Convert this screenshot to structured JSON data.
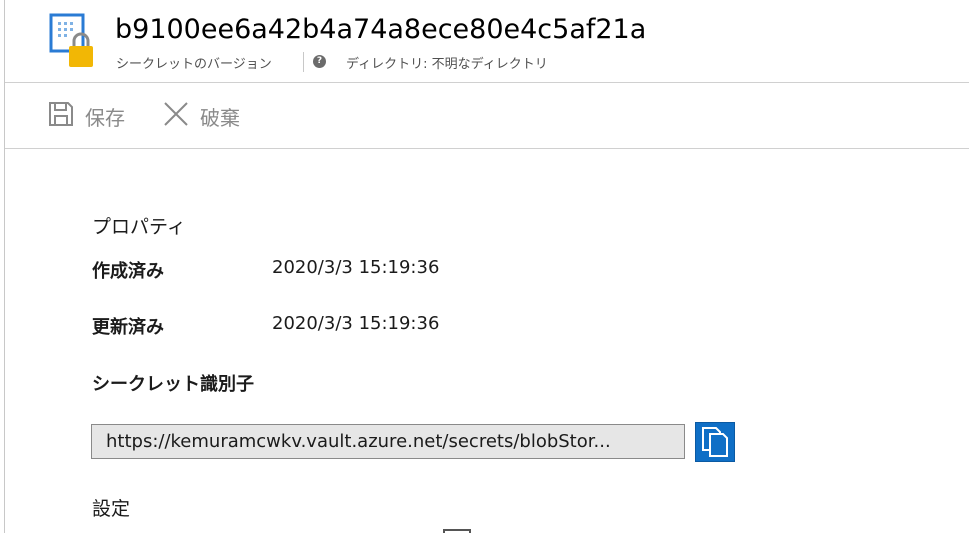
{
  "header": {
    "title": "b9100ee6a42b4a74a8ece80e4c5af21a",
    "subtitle": "シークレットのバージョン",
    "directory": "ディレクトリ: 不明なディレクトリ",
    "help_symbol": "?",
    "icon": "key-vault-secret-lock-icon"
  },
  "toolbar": {
    "save_label": "保存",
    "discard_label": "破棄",
    "save_icon": "save-icon",
    "discard_icon": "close-icon"
  },
  "properties": {
    "heading": "プロパティ",
    "created_label": "作成済み",
    "created_value": "2020/3/3 15:19:36",
    "updated_label": "更新済み",
    "updated_value": "2020/3/3 15:19:36",
    "secret_id_label": "シークレット識別子",
    "secret_id_value": "https://kemuramcwkv.vault.azure.net/secrets/blobStor...",
    "copy_icon": "copy-icon"
  },
  "settings": {
    "heading": "設定"
  },
  "colors": {
    "accent": "#0f6fc6",
    "lock": "#f2b705",
    "icon_blue": "#2a7bd4"
  }
}
